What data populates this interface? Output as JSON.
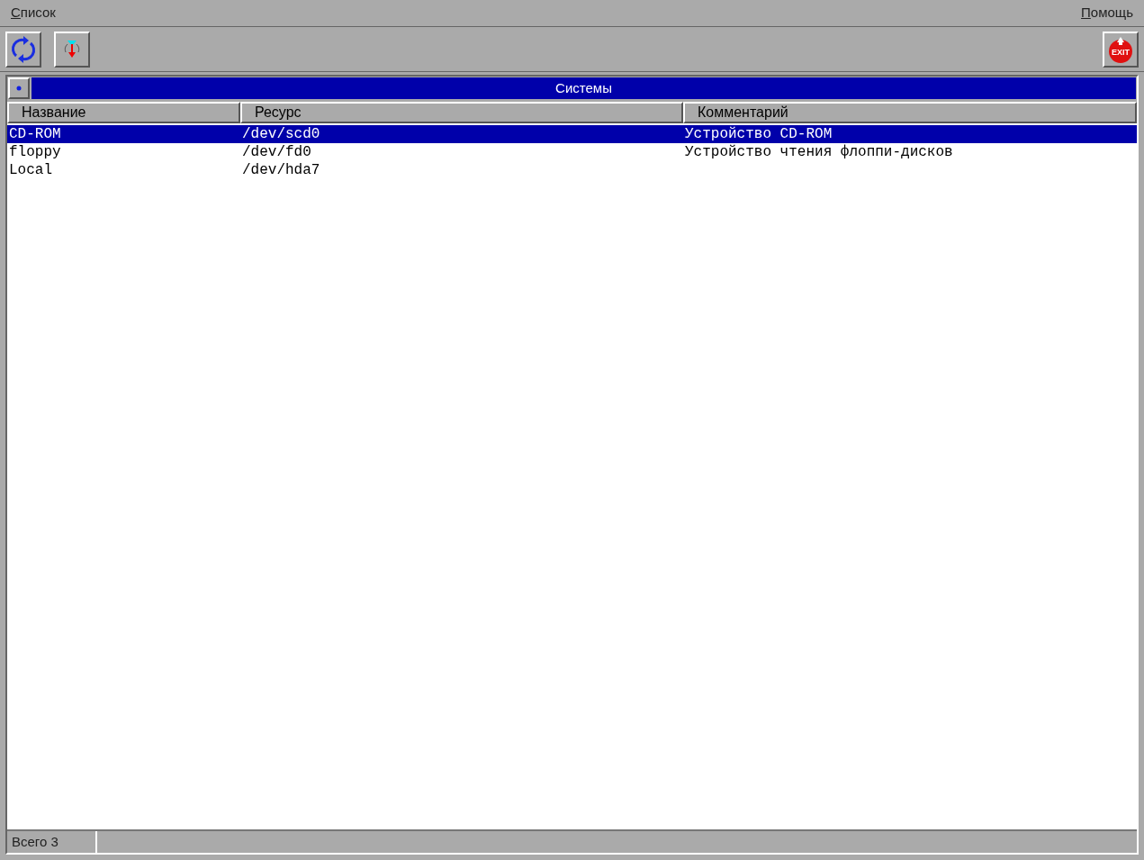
{
  "menu": [
    {
      "label": "Список"
    },
    {
      "label": "Помощь"
    }
  ],
  "toolbar": {
    "exit_label": "EXIT"
  },
  "panel": {
    "title": "Системы"
  },
  "table": {
    "columns": [
      "Название",
      "Ресурс",
      "Комментарий"
    ],
    "rows": [
      {
        "cells": [
          "CD-ROM",
          "/dev/scd0",
          "Устройство CD-ROM"
        ],
        "selected": true
      },
      {
        "cells": [
          "floppy",
          "/dev/fd0",
          "Устройство чтения флоппи-дисков"
        ],
        "selected": false
      },
      {
        "cells": [
          "Local",
          "/dev/hda7",
          ""
        ],
        "selected": false
      }
    ]
  },
  "status_bar": {
    "text": "Всего 3"
  }
}
